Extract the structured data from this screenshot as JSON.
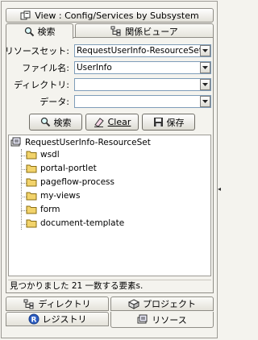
{
  "view_title": "View : Config/Services by Subsystem",
  "tabs_top": [
    {
      "label": "検索",
      "active": true
    },
    {
      "label": "関係ビューア",
      "active": false
    }
  ],
  "form": {
    "resource_set_label": "リソースセット:",
    "resource_set_value": "RequestUserInfo-ResourceSet",
    "file_name_label": "ファイル名:",
    "file_name_value": "UserInfo",
    "directory_label": "ディレクトリ:",
    "directory_value": "",
    "data_label": "データ:",
    "data_value": ""
  },
  "buttons": {
    "search": "検索",
    "clear": "Clear",
    "save": "保存"
  },
  "tree": {
    "root": "RequestUserInfo-ResourceSet",
    "items": [
      "wsdl",
      "portal-portlet",
      "pageflow-process",
      "my-views",
      "form",
      "document-template"
    ]
  },
  "status_text": "見つかりました 21 一数する要素s.",
  "tabs_bottom": [
    {
      "label": "ディレクトリ",
      "icon": "directory-icon"
    },
    {
      "label": "プロジェクト",
      "icon": "project-icon"
    },
    {
      "label": "レジストリ",
      "icon": "registry-icon"
    },
    {
      "label": "リソース",
      "icon": "resource-icon",
      "active": true
    }
  ],
  "colors": {
    "background": "#f4f3ee",
    "folder": "#f2d36b",
    "field_border": "#7f9db9",
    "registry_blue": "#2b5cc2"
  }
}
